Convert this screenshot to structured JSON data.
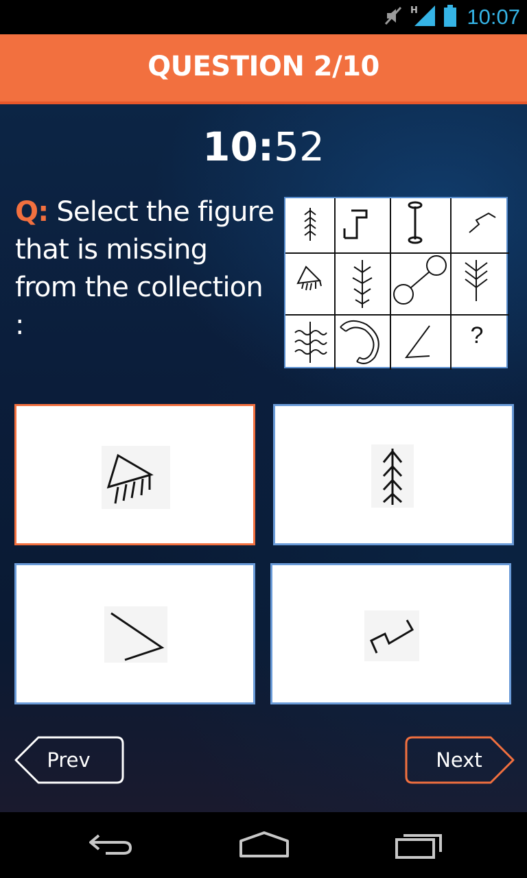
{
  "status_bar": {
    "time": "10:07",
    "icons": [
      "mute-icon",
      "signal-h-icon",
      "battery-icon"
    ],
    "network_label": "H"
  },
  "header": {
    "title": "QUESTION 2/10"
  },
  "timer": {
    "minutes": "10:",
    "seconds": "52"
  },
  "question": {
    "prefix": "Q:",
    "text": " Select the figure that is missing from the collection :"
  },
  "puzzle": {
    "missing_mark": "?",
    "cells": [
      "arrow-tree-glyph",
      "step-line-glyph",
      "i-beam-glyph",
      "zigzag-s-glyph",
      "fan-rake-glyph",
      "branch-tree-glyph",
      "dumbbell-glyph",
      "wheat-glyph",
      "wavy-tree-glyph",
      "hook-glyph",
      "angle-glyph",
      "question-mark"
    ]
  },
  "options": [
    {
      "figure": "fan-rake-glyph",
      "selected": true
    },
    {
      "figure": "pine-tree-glyph",
      "selected": false
    },
    {
      "figure": "angle-glyph",
      "selected": false
    },
    {
      "figure": "zigzag-glyph",
      "selected": false
    }
  ],
  "navigation": {
    "prev_label": "Prev",
    "next_label": "Next"
  },
  "colors": {
    "accent": "#f2703f",
    "option_border": "#6a9bd8",
    "clock": "#35b4e6"
  }
}
